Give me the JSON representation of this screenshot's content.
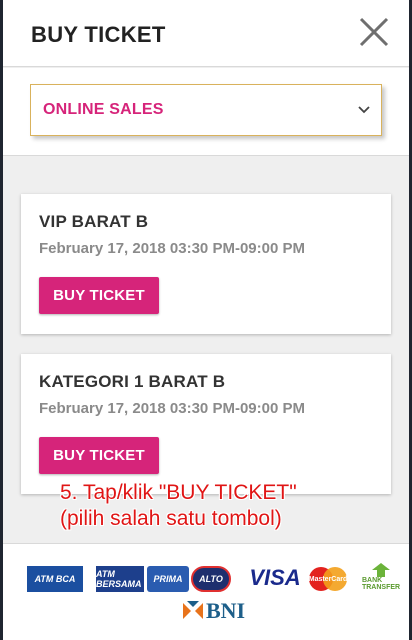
{
  "header": {
    "title": "BUY TICKET",
    "close_icon": "close-icon"
  },
  "sales_select": {
    "value": "ONLINE SALES",
    "icon": "chevron-down-icon"
  },
  "tickets": [
    {
      "name": "VIP BARAT B",
      "date": "February 17, 2018 03:30 PM-09:00 PM",
      "button_label": "BUY TICKET"
    },
    {
      "name": "KATEGORI 1 BARAT B",
      "date": "February 17, 2018 03:30 PM-09:00 PM",
      "button_label": "BUY TICKET"
    }
  ],
  "annotation": {
    "line1": "5. Tap/klik \"BUY TICKET\"",
    "line2": "(pilih salah satu tombol)"
  },
  "payment_logos": {
    "atm_bca": "ATM BCA",
    "atm_bersama": "ATM BERSAMA",
    "prima": "PRIMA",
    "alto": "ALTO",
    "visa": "VISA",
    "mastercard": "MasterCard",
    "bank_transfer": "BANK TRANSFER",
    "bni": "BNI"
  },
  "colors": {
    "accent": "#d6247a",
    "select_border": "#d9b25c",
    "annotation": "#e01515"
  }
}
